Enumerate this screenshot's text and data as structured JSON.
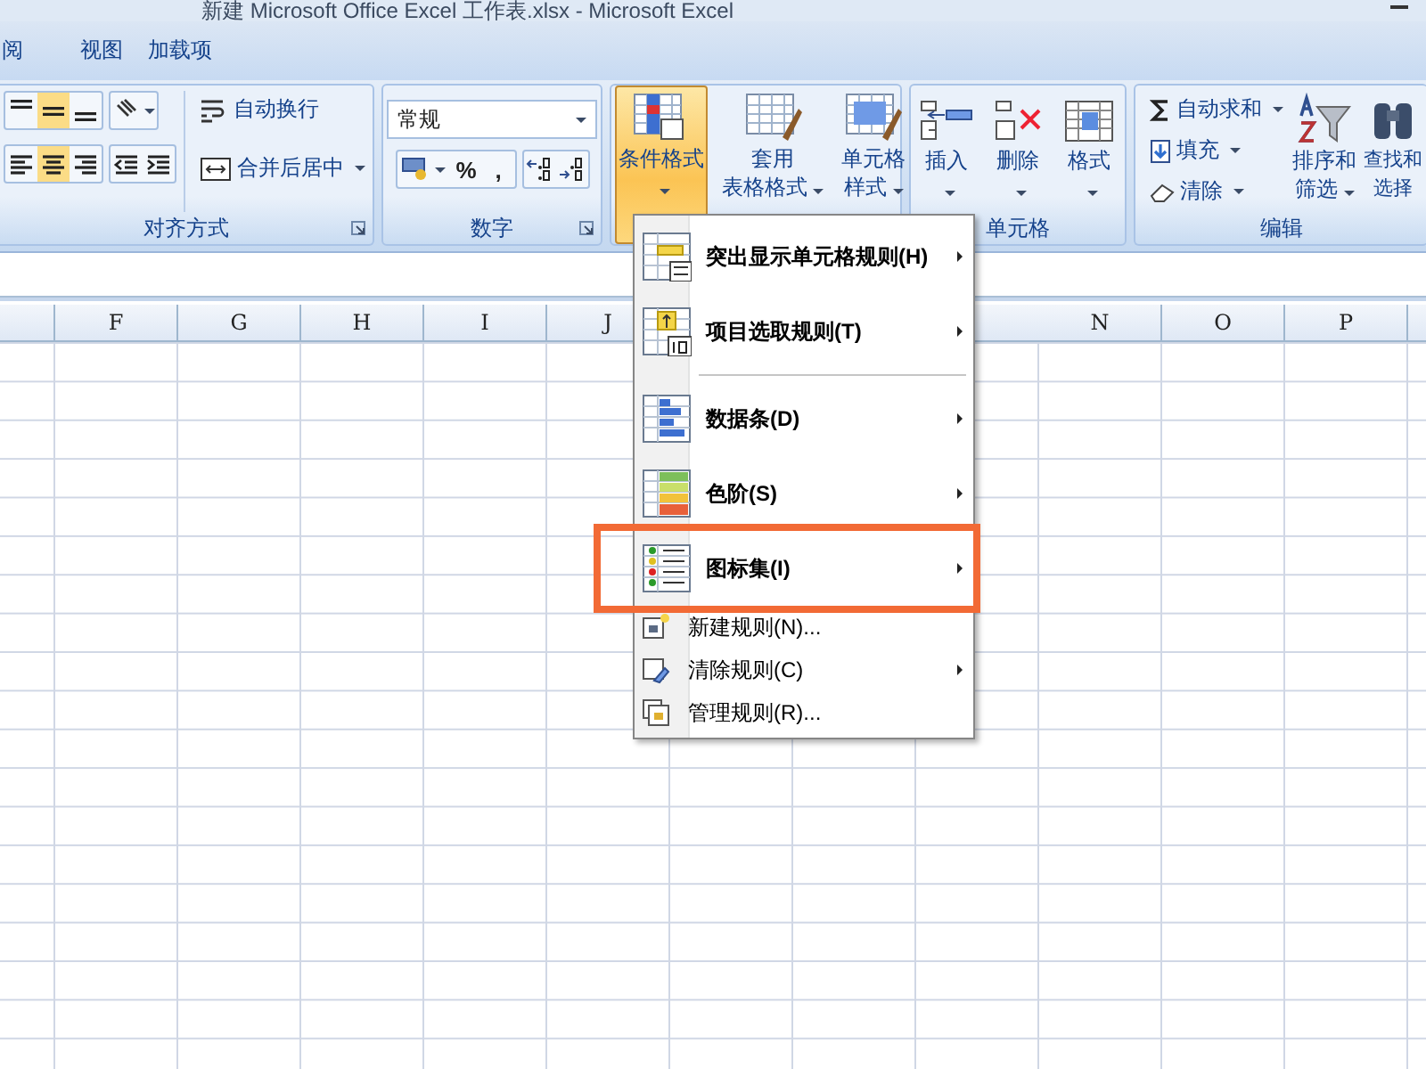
{
  "window": {
    "title": "新建 Microsoft Office Excel 工作表.xlsx - Microsoft Excel"
  },
  "tabs": [
    {
      "label": "阅",
      "selected": false
    },
    {
      "label": "视图",
      "selected": false
    },
    {
      "label": "加载项",
      "selected": false
    }
  ],
  "ribbon": {
    "alignment": {
      "label": "对齐方式",
      "vertical_align": [
        {
          "selected": false
        },
        {
          "selected": true
        },
        {
          "selected": false
        }
      ],
      "horizontal_align": [
        {
          "selected": false
        },
        {
          "selected": true
        },
        {
          "selected": false
        }
      ],
      "wrap_text": "自动换行",
      "merge_center": "合并后居中"
    },
    "number": {
      "label": "数字",
      "format": "常规",
      "percent": "%",
      "comma": ","
    },
    "styles": {
      "conditional_format": {
        "label": "条件格式",
        "open": true
      },
      "format_as_table": [
        "套用",
        "表格格式"
      ],
      "cell_styles": [
        "单元格",
        "样式"
      ]
    },
    "cells": {
      "label": "单元格",
      "buttons": [
        "插入",
        "删除",
        "格式"
      ]
    },
    "editing": {
      "label": "编辑",
      "autosum": "自动求和",
      "fill": "填充",
      "clear": "清除",
      "sort_filter": [
        "排序和",
        "筛选"
      ],
      "find_select": [
        "查找和",
        "选择"
      ]
    }
  },
  "columns_left": [
    "F",
    "G",
    "H",
    "I",
    "J"
  ],
  "columns_right": [
    "N",
    "O",
    "P"
  ],
  "menu": {
    "items": [
      {
        "kind": "large",
        "label": "突出显示单元格规则(H)",
        "submenu": true,
        "framed": false
      },
      {
        "kind": "large",
        "label": "项目选取规则(T)",
        "submenu": true,
        "framed": false
      },
      {
        "kind": "separator"
      },
      {
        "kind": "large",
        "label": "数据条(D)",
        "submenu": true,
        "framed": false
      },
      {
        "kind": "large",
        "label": "色阶(S)",
        "submenu": true,
        "framed": false
      },
      {
        "kind": "large",
        "label": "图标集(I)",
        "submenu": true,
        "framed": true
      },
      {
        "kind": "small",
        "label": "新建规则(N)...",
        "submenu": false,
        "framed": false
      },
      {
        "kind": "small",
        "label": "清除规则(C)",
        "submenu": true,
        "framed": false
      },
      {
        "kind": "small",
        "label": "管理规则(R)...",
        "submenu": false,
        "framed": false
      }
    ]
  }
}
